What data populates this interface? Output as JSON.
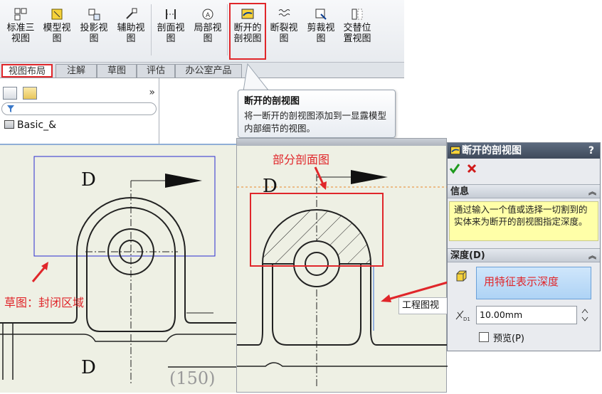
{
  "toolbar": {
    "buttons": [
      {
        "label": "标准三\n视图",
        "icon": "standard-3-view-icon"
      },
      {
        "label": "模型视\n图",
        "icon": "model-view-icon"
      },
      {
        "label": "投影视\n图",
        "icon": "projected-view-icon"
      },
      {
        "label": "辅助视\n图",
        "icon": "auxiliary-view-icon"
      },
      {
        "label": "剖面视\n图",
        "icon": "section-view-icon"
      },
      {
        "label": "局部视\n图",
        "icon": "detail-view-icon"
      },
      {
        "label": "断开的\n剖视图",
        "icon": "broken-out-section-icon"
      },
      {
        "label": "断裂视\n图",
        "icon": "break-view-icon"
      },
      {
        "label": "剪裁视\n图",
        "icon": "crop-view-icon"
      },
      {
        "label": "交替位\n置视图",
        "icon": "alternate-position-view-icon"
      }
    ]
  },
  "tabs": [
    "视图布局",
    "注解",
    "草图",
    "评估",
    "办公室产品"
  ],
  "left_panel": {
    "tree_root": "Basic_&",
    "collapse_glyph": "»"
  },
  "tooltip": {
    "title": "断开的剖视图",
    "body": "将一断开的剖视图添加到一显露模型内部细节的视图。"
  },
  "annotations": {
    "left_label": "草图：封闭区域",
    "right_label": "部分剖面图",
    "face_hint": "用特征表示深度"
  },
  "drawing": {
    "view_letter": "D",
    "scale_text": "(150)",
    "callout": "工程图视"
  },
  "property_manager": {
    "title": "断开的剖视图",
    "help": "?",
    "info_header": "信息",
    "info_text": "通过输入一个值或选择一切割到的实体来为断开的剖视图指定深度。",
    "depth_header": "深度(D)",
    "depth_value": "10.00mm",
    "preview_label": "预览(P)",
    "preview_checked": false
  },
  "colors": {
    "annotation_red": "#e0262a",
    "message_yellow": "#ffffa8",
    "drawing_bg": "#eef0e4"
  }
}
